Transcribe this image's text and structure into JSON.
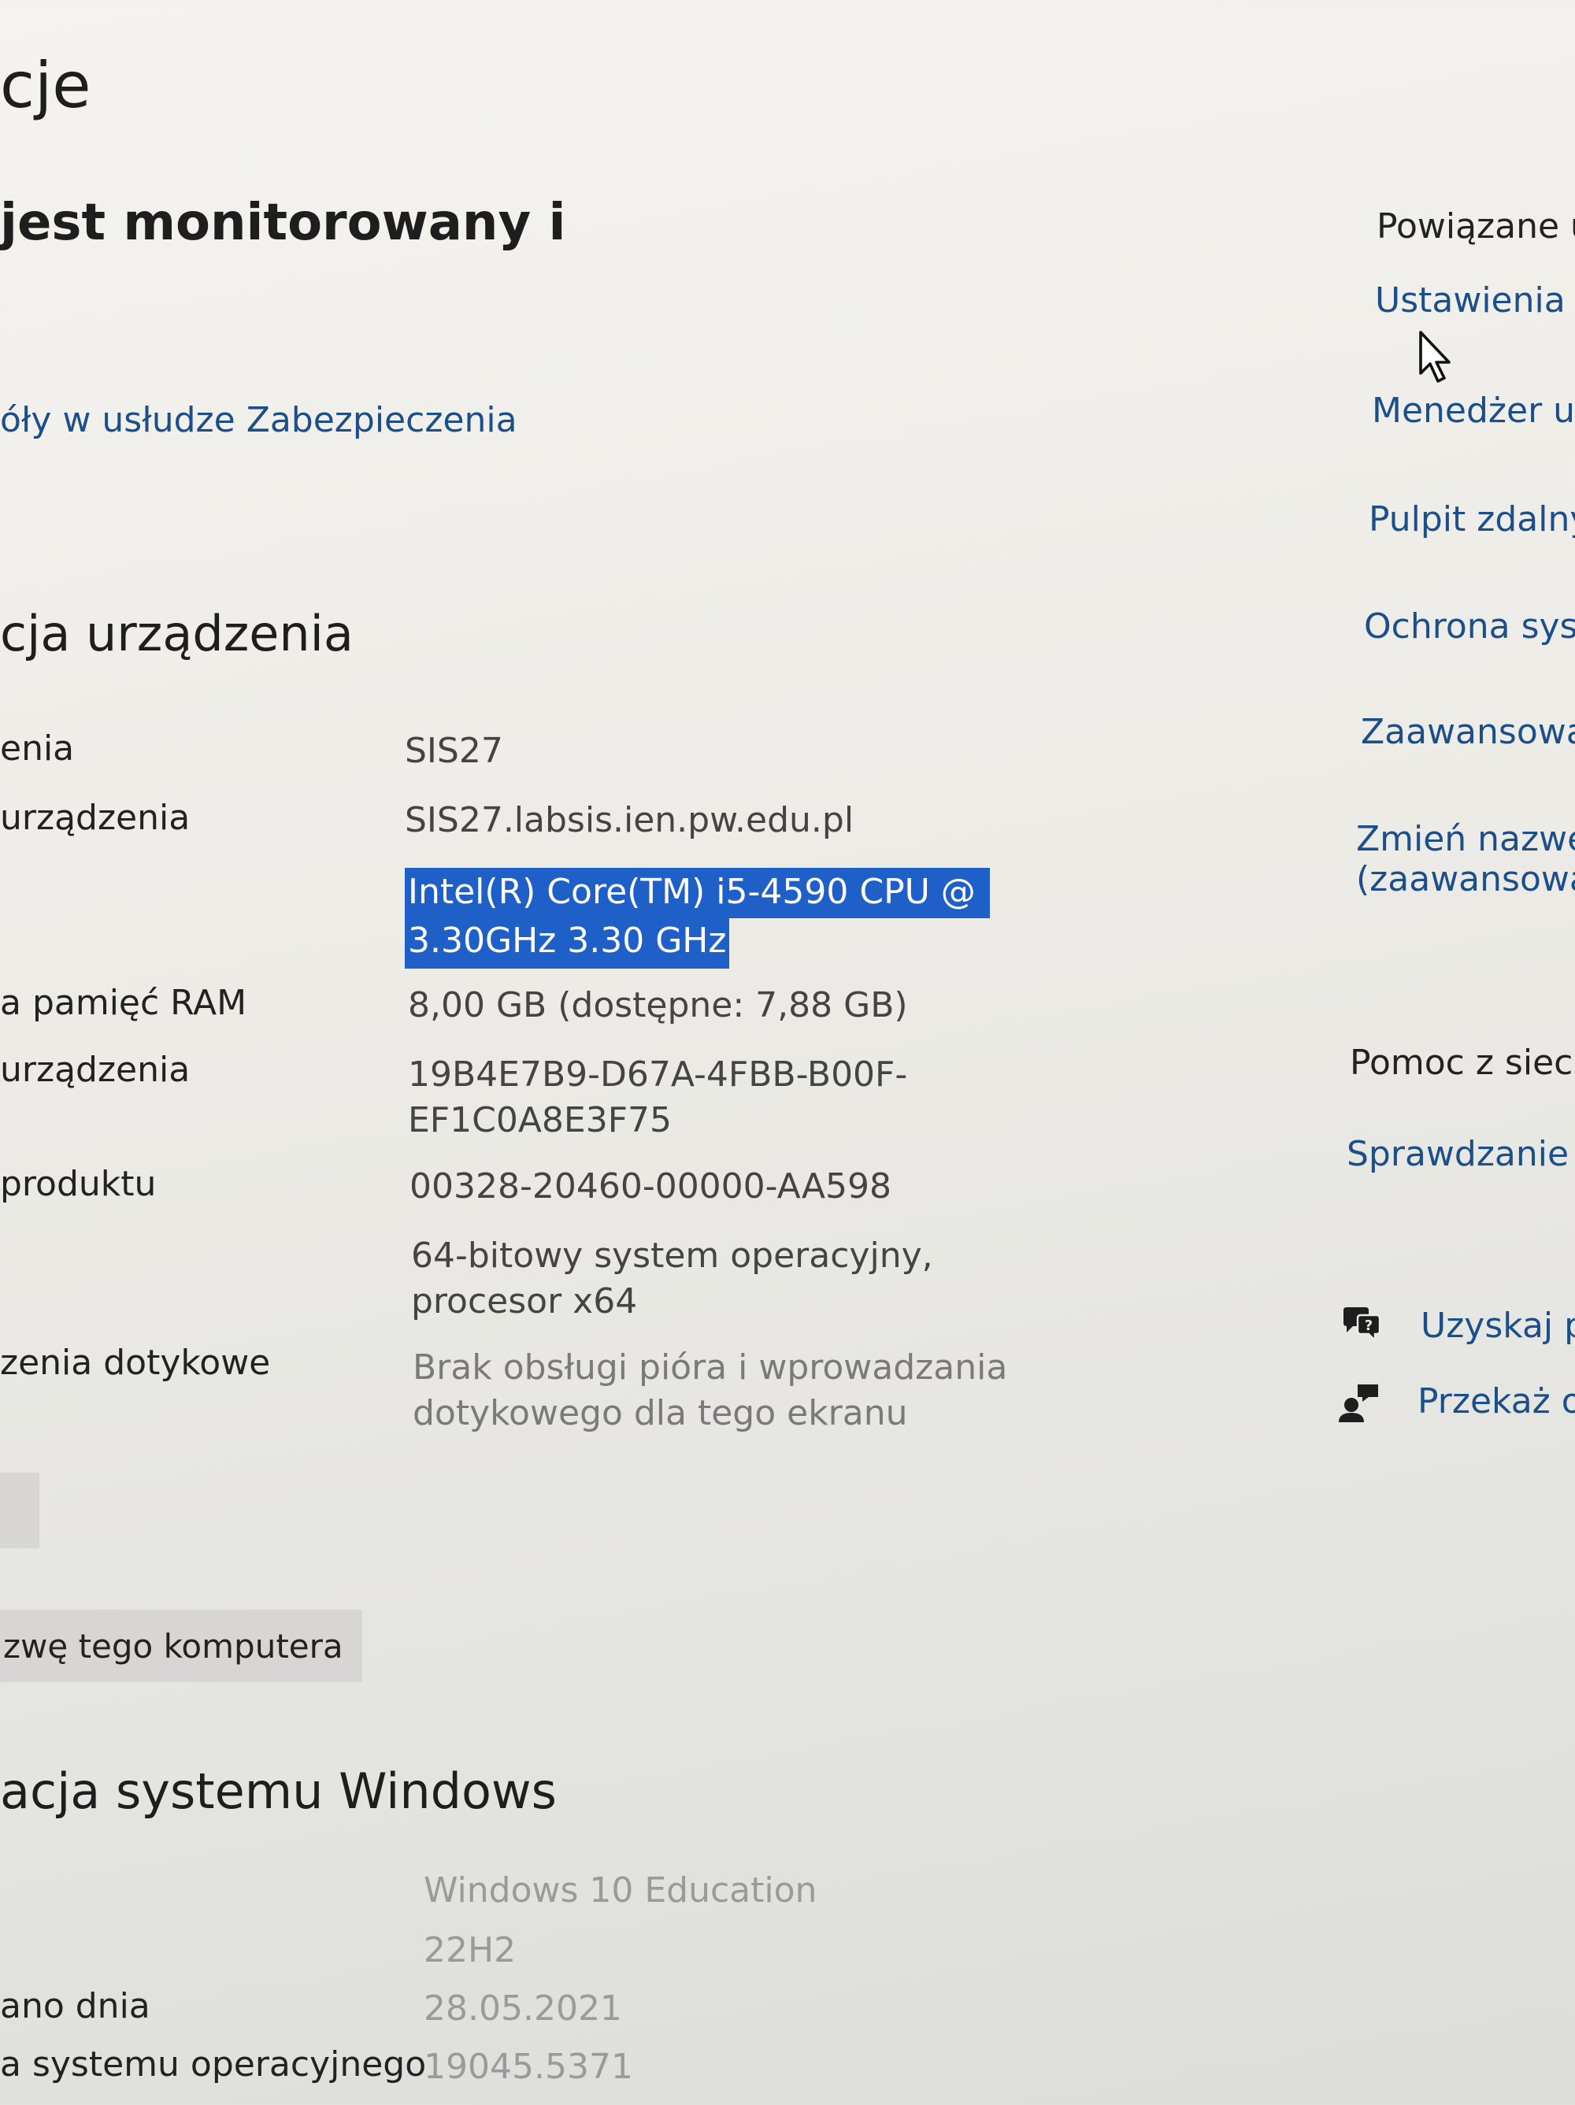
{
  "header": {
    "title": "cje",
    "status_line": "jest monitorowany i",
    "security_link": "óły w usłudze Zabezpieczenia"
  },
  "device": {
    "heading": "cja urządzenia",
    "rows": [
      {
        "label": "enia",
        "value": "SIS27"
      },
      {
        "label": "urządzenia",
        "value": "SIS27.labsis.ien.pw.edu.pl"
      },
      {
        "label": "",
        "value_line1": "Intel(R) Core(TM) i5-4590 CPU @",
        "value_line2": "3.30GHz   3.30 GHz",
        "selected": true
      },
      {
        "label": "a pamięć RAM",
        "value": "8,00 GB (dostępne: 7,88 GB)"
      },
      {
        "label": "urządzenia",
        "value_line1": "19B4E7B9-D67A-4FBB-B00F-",
        "value_line2": "EF1C0A8E3F75"
      },
      {
        "label": "produktu",
        "value": "00328-20460-00000-AA598"
      },
      {
        "label": "",
        "value_line1": "64-bitowy system operacyjny,",
        "value_line2": "procesor x64"
      },
      {
        "label": "zenia dotykowe",
        "value_line1": "Brak obsługi pióra i wprowadzania",
        "value_line2": "dotykowego dla tego ekranu"
      }
    ],
    "rename_button": "zwę tego komputera"
  },
  "windows": {
    "heading": "acja systemu Windows",
    "rows": [
      {
        "label": "",
        "value": "Windows 10 Education"
      },
      {
        "label": "",
        "value": "22H2"
      },
      {
        "label": "ano dnia",
        "value": "28.05.2021"
      },
      {
        "label": "a systemu operacyjnego",
        "value": "19045.5371"
      }
    ]
  },
  "related": {
    "heading": "Powiązane u",
    "links": [
      "Ustawienia f",
      "Menedżer ur",
      "Pulpit zdalny",
      "Ochrona syst",
      "Zaawansowar",
      "Zmień nazwę",
      "(zaawansowar"
    ],
    "help_heading": "Pomoc z sieci",
    "help_link": "Sprawdzanie o",
    "get_help": "Uzyskaj po",
    "feedback": "Przekaż op"
  },
  "colors": {
    "link": "#1c4f8a",
    "selection": "#1f5fc8",
    "button": "#d8d6d4"
  },
  "icons": [
    "mouse-pointer-icon",
    "get-help-icon",
    "feedback-icon"
  ]
}
